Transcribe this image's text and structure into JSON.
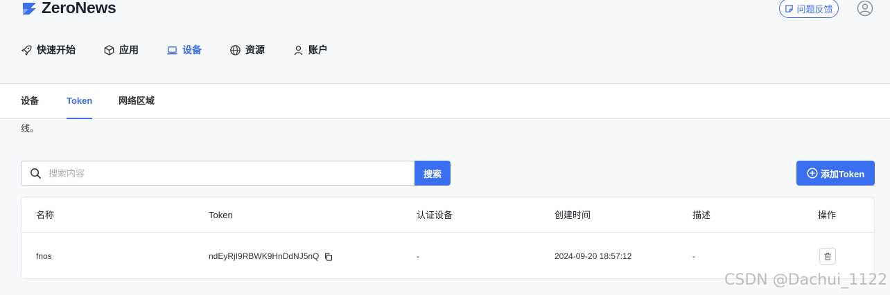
{
  "header": {
    "logo_text": "ZeroNews",
    "feedback_label": "问题反馈",
    "brand_color": "#3a6ff0"
  },
  "nav": {
    "items": [
      {
        "label": "快速开始",
        "icon": "rocket-icon"
      },
      {
        "label": "应用",
        "icon": "cube-icon"
      },
      {
        "label": "设备",
        "icon": "laptop-icon",
        "active": true
      },
      {
        "label": "资源",
        "icon": "globe-icon"
      },
      {
        "label": "账户",
        "icon": "user-icon"
      }
    ]
  },
  "tabs": {
    "items": [
      {
        "label": "设备"
      },
      {
        "label": "Token",
        "active": true
      },
      {
        "label": "网络区域"
      }
    ]
  },
  "note_text": "线。",
  "search": {
    "placeholder": "搜索内容",
    "button_label": "搜索"
  },
  "add_button_label": "添加Token",
  "table": {
    "headers": [
      "名称",
      "Token",
      "认证设备",
      "创建时间",
      "描述",
      "操作"
    ],
    "rows": [
      {
        "name": "fnos",
        "token": "ndEyRjI9RBWK9HnDdNJ5nQ",
        "devices": "-",
        "created": "2024-09-20 18:57:12",
        "description": "-"
      }
    ]
  },
  "watermark": "CSDN @Dachui_1122"
}
